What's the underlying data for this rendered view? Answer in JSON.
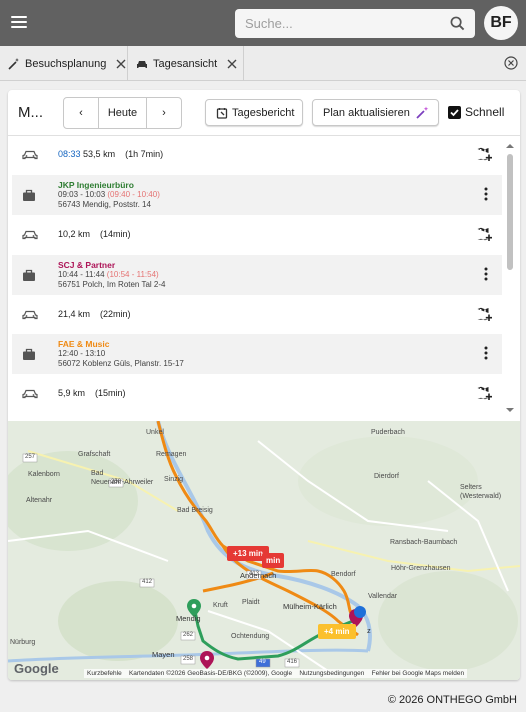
{
  "header": {
    "search_placeholder": "Suche...",
    "avatar_initials": "BF"
  },
  "tabs": [
    {
      "label": "Besuchsplanung"
    },
    {
      "label": "Tagesansicht"
    }
  ],
  "toolbar": {
    "title": "M...",
    "prev": "‹",
    "today": "Heute",
    "next": "›",
    "report_label": "Tagesbericht",
    "plan_label": "Plan aktualisieren",
    "fast_label": "Schnell",
    "fast_checked": true
  },
  "list": {
    "drive_1": {
      "time": "08:33",
      "distance": "53,5 km",
      "duration": "(1h 7min)"
    },
    "visit_1": {
      "name": "JKP Ingenieurbüro",
      "name_color": "#2e7d32",
      "time": "09:03 - 10:03",
      "alt_time": "(09:40 - 10:40)",
      "address": "56743 Mendig, Poststr. 14"
    },
    "drive_2": {
      "distance": "10,2 km",
      "duration": "(14min)"
    },
    "visit_2": {
      "name": "SCJ & Partner",
      "name_color": "#ad1457",
      "time": "10:44 - 11:44",
      "alt_time": "(10:54 - 11:54)",
      "address": "56751 Polch, Im Roten Tal 2-4"
    },
    "drive_3": {
      "distance": "21,4 km",
      "duration": "(22min)"
    },
    "visit_3": {
      "name": "FAE & Music",
      "name_color": "#ef8a14",
      "time": "12:40 - 13:10",
      "address": "56072 Koblenz Güls, Planstr. 15-17"
    },
    "drive_4": {
      "distance": "5,9 km",
      "duration": "(15min)"
    }
  },
  "map": {
    "places": {
      "unkel": "Unkel",
      "puderbach": "Puderbach",
      "grafschaft": "Grafschaft",
      "kalenborn": "Kalenborn",
      "bad_neuenahr": "Bad\nNeuenahr-Ahrweiler",
      "remagen": "Remagen",
      "dierdorf": "Dierdorf",
      "altenahr": "Altenahr",
      "sinzig": "Sinzig",
      "selters": "Selters\n(Westerwald)",
      "bad_breisig": "Bad Breisig",
      "ransbach": "Ransbach-Baumbach",
      "andernach": "Andernach",
      "bendorf": "Bendorf",
      "hoehr": "Höhr-Grenzhausen",
      "vallendar": "Vallendar",
      "kruft": "Kruft",
      "plaidt": "Plaidt",
      "muelheim": "Mülheim-Kärlich",
      "mendig": "Mendig",
      "ochtendung": "Ochtendung",
      "mayen": "Mayen",
      "nurburg": "Nürburg",
      "koblenz_z": "z"
    },
    "roads": {
      "r257": "257",
      "r258": "258",
      "r412": "412",
      "r413": "413",
      "r262": "262",
      "r258b": "258",
      "r416": "416",
      "r49": "49"
    },
    "badges": {
      "plus13": "+13 min",
      "min": "min",
      "plus4": "+4 min"
    },
    "route_colors": {
      "orange": "#ef8a14",
      "green": "#2e9e5b",
      "blue": "#1e6fd9"
    },
    "footer_items": [
      "Kurzbefehle",
      "Kartendaten ©2026 GeoBasis-DE/BKG (©2009), Google",
      "Nutzungsbedingungen",
      "Fehler bei Google Maps melden"
    ],
    "logo": "Google"
  },
  "footer": {
    "copyright": "© 2026 ONTHEGO GmbH"
  }
}
